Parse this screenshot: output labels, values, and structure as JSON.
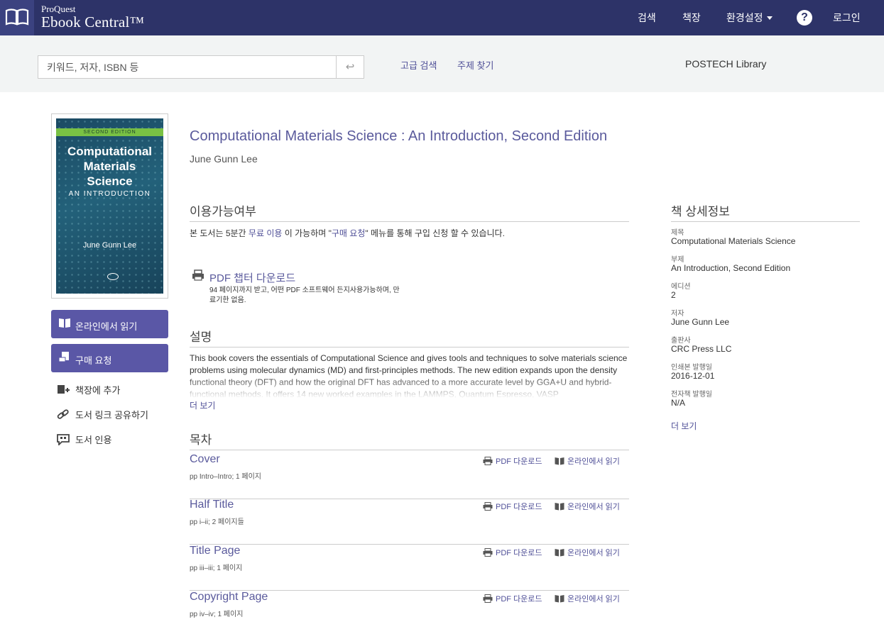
{
  "brand": {
    "small": "ProQuest",
    "big": "Ebook Central™"
  },
  "nav": {
    "search": "검색",
    "bookshelf": "책장",
    "settings": "환경설정",
    "help": "?",
    "login": "로그인"
  },
  "search": {
    "placeholder": "키워드, 저자, ISBN 등",
    "advanced": "고급 검색",
    "subject": "주제 찾기",
    "library": "POSTECH Library"
  },
  "cover": {
    "band": "SECOND EDITION",
    "title_line1": "Computational",
    "title_line2": "Materials",
    "title_line3": "Science",
    "subtitle": "AN INTRODUCTION",
    "author": "June Gunn Lee"
  },
  "actions": {
    "read_online": "온라인에서 읽기",
    "purchase_request": "구매 요청",
    "add_shelf": "책장에 추가",
    "share_link": "도서 링크 공유하기",
    "cite": "도서 인용"
  },
  "book": {
    "title": "Computational Materials Science : An Introduction, Second Edition",
    "author": "June Gunn Lee"
  },
  "availability": {
    "heading": "이용가능여부",
    "text_a": "본 도서는 5분간 ",
    "link_free": "무료 이용",
    "text_b": " 이 가능하며 \"",
    "link_purchase": "구매 요청",
    "text_c": "\" 메뉴를 통해 구입 신청 할 수 있습니다.",
    "pdf_chapter": "PDF 챕터 다운로드",
    "pdf_note": "94 페이지까지 받고, 어떤 PDF 소프트웨어 든지사용가능하며, 만료기한 없음."
  },
  "description": {
    "heading": "설명",
    "text": "This book covers the essentials of Computational Science and gives tools and techniques to solve materials science problems using molecular dynamics (MD) and first-principles methods. The new edition expands upon the density functional theory (DFT) and how the original DFT has advanced to a more accurate level by GGA+U and hybrid-functional methods. It offers 14 new worked examples in the LAMMPS, Quantum Espresso, VASP",
    "more": "더 보기"
  },
  "toc": {
    "heading": "목차",
    "pdf_label": "PDF 다운로드",
    "read_label": "온라인에서 읽기",
    "entries": [
      {
        "title": "Cover",
        "pages": "pp Intro–Intro; 1 페이지"
      },
      {
        "title": "Half Title",
        "pages": "pp i–ii; 2 페이지들"
      },
      {
        "title": "Title Page",
        "pages": "pp iii–iii; 1 페이지"
      },
      {
        "title": "Copyright Page",
        "pages": "pp iv–iv; 1 페이지"
      }
    ]
  },
  "details": {
    "heading": "책 상세정보",
    "items": [
      {
        "label": "제목",
        "value": "Computational Materials Science"
      },
      {
        "label": "부제",
        "value": "An Introduction, Second Edition"
      },
      {
        "label": "에디션",
        "value": "2"
      },
      {
        "label": "저자",
        "value": "June Gunn Lee"
      },
      {
        "label": "출판사",
        "value": "CRC Press LLC"
      },
      {
        "label": "인쇄본 발행일",
        "value": "2016-12-01"
      },
      {
        "label": "전자책 발행일",
        "value": "N/A"
      }
    ],
    "more": "더 보기"
  }
}
